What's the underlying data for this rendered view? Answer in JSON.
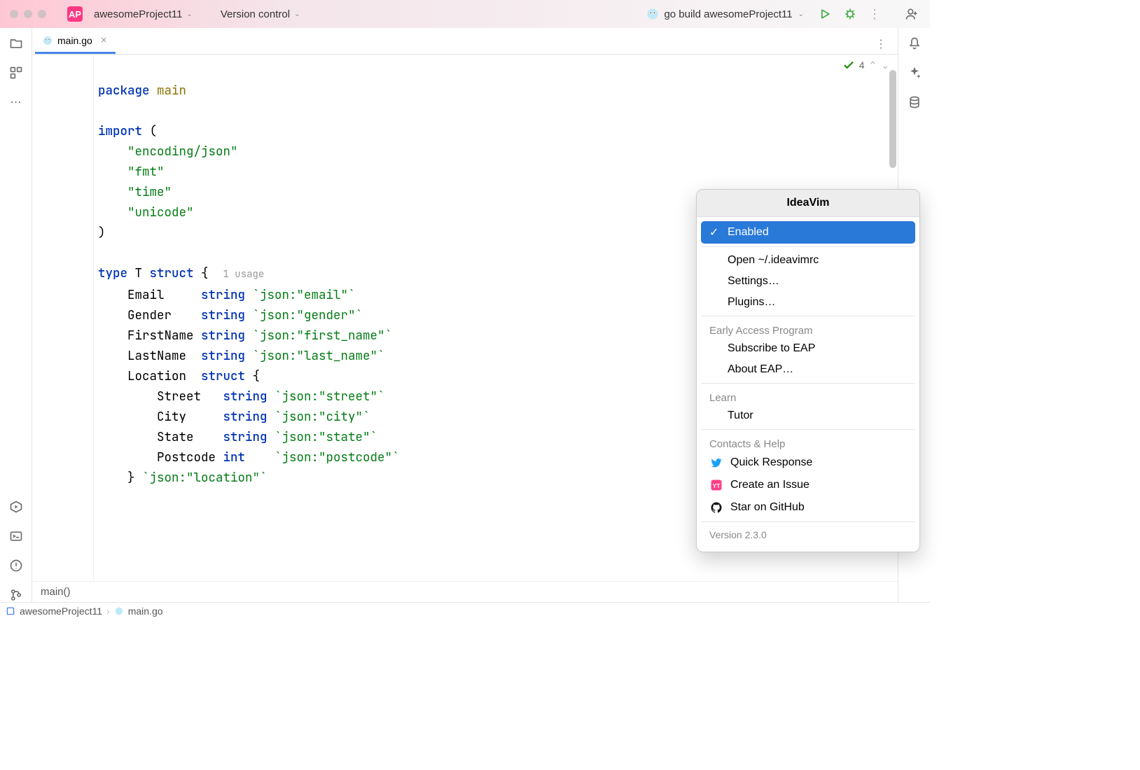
{
  "titlebar": {
    "project_badge": "AP",
    "project_name": "awesomeProject11",
    "vcs_label": "Version control",
    "run_config": "go build awesomeProject11"
  },
  "tabs": {
    "active": {
      "name": "main.go"
    }
  },
  "inspection": {
    "count": "4"
  },
  "code": {
    "l1_kw": "package",
    "l1_pkg": "main",
    "l2_kw": "import",
    "l2_p": "(",
    "imp1": "\"encoding/json\"",
    "imp2": "\"fmt\"",
    "imp3": "\"time\"",
    "imp4": "\"unicode\"",
    "l6_p": ")",
    "l7_kw": "type",
    "l7_name": "T",
    "l7_struct": "struct",
    "l7_p": "{",
    "l7_hint": "1 usage",
    "f1_name": "Email",
    "f1_type": "string",
    "f1_tag": "`json:\"email\"`",
    "f2_name": "Gender",
    "f2_type": "string",
    "f2_tag": "`json:\"gender\"`",
    "f3_name": "FirstName",
    "f3_type": "string",
    "f3_tag": "`json:\"first_name\"`",
    "f4_name": "LastName",
    "f4_type": "string",
    "f4_tag": "`json:\"last_name\"`",
    "f5_name": "Location",
    "f5_type": "struct",
    "f5_p": "{",
    "s1_name": "Street",
    "s1_type": "string",
    "s1_tag": "`json:\"street\"`",
    "s2_name": "City",
    "s2_type": "string",
    "s2_tag": "`json:\"city\"`",
    "s3_name": "State",
    "s3_type": "string",
    "s3_tag": "`json:\"state\"`",
    "s4_name": "Postcode",
    "s4_type": "int",
    "s4_tag": "`json:\"postcode\"`",
    "f5_close": "}",
    "f5_closetag": "`json:\"location\"`"
  },
  "breadcrumb_editor": "main()",
  "statusbar": {
    "project": "awesomeProject11",
    "file": "main.go"
  },
  "popup": {
    "title": "IdeaVim",
    "items": {
      "enabled": "Enabled",
      "open_rc": "Open ~/.ideavimrc",
      "settings": "Settings…",
      "plugins": "Plugins…"
    },
    "group_eap": "Early Access Program",
    "eap_subscribe": "Subscribe to EAP",
    "eap_about": "About EAP…",
    "group_learn": "Learn",
    "tutor": "Tutor",
    "group_contacts": "Contacts & Help",
    "quick_response": "Quick Response",
    "create_issue": "Create an Issue",
    "star_github": "Star on GitHub",
    "version": "Version 2.3.0"
  }
}
